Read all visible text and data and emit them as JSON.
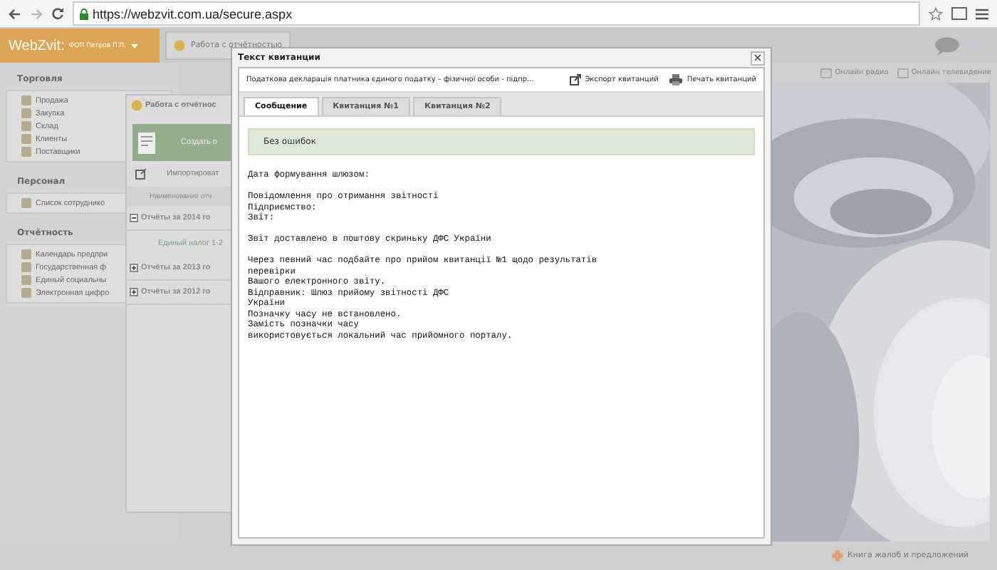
{
  "browser": {
    "url": "https://webzvit.com.ua/secure.aspx"
  },
  "app_header": {
    "logo": "WebZvit:",
    "account": "ФОП Петров П.П.",
    "tab": "Работа с отчётностью"
  },
  "header_links": [
    "Онлайн радио",
    "Онлайн телевидение"
  ],
  "sidebar": [
    {
      "title": "Торговля",
      "items": [
        "Продажа",
        "Закупка",
        "Склад",
        "Клиенты",
        "Поставщики"
      ]
    },
    {
      "title": "Персонал",
      "items": [
        "Список сотруднико"
      ]
    },
    {
      "title": "Отчётность",
      "items": [
        "Календарь предпри",
        "Государственная ф",
        "Единый социальны",
        "Электронная цифро"
      ]
    }
  ],
  "reports_window": {
    "title": "Работа с отчётнос",
    "create_button": "Создать о",
    "import_button": "Импортироват",
    "column_header": "Наименование отч",
    "groups": [
      {
        "label": "Отчёты за 2014 го",
        "expanded": true,
        "children": [
          {
            "label": "Единый налог 1-2"
          }
        ]
      },
      {
        "label": "Отчёты за 2013 го",
        "expanded": false
      },
      {
        "label": "Отчёты за 2012 го",
        "expanded": false
      }
    ]
  },
  "dialog": {
    "title": "Текст квитанции",
    "close": "×",
    "document": "Податкова декларація платника єдиного податку – фізичної особи - підпр...",
    "actions": [
      "Экспорт квитанций",
      "Печать квитанций"
    ],
    "tabs": [
      {
        "label": "Сообщение",
        "selected": true
      },
      {
        "label": "Квитанция №1",
        "selected": false
      },
      {
        "label": "Квитанция №2",
        "selected": false
      }
    ],
    "status": "Без ошибок",
    "paragraphs": [
      [
        "Дата формування шлюзом:"
      ],
      [
        "Повідомлення про отримання звітності",
        "Підприємство:",
        "Звіт:"
      ],
      [
        "Звіт доставлено в поштову скриньку ДФС України"
      ],
      [
        "Через певний час подбайте про прийом квитанції №1 щодо результатів",
        "перевірки",
        "Вашого електронного звіту.",
        "Відправник: Шлюз прийому звітності ДФС",
        "України",
        "Позначку часу не встановлено.",
        "Замість позначки часу",
        "використовується локальний час прийомного порталу."
      ]
    ]
  },
  "footer_link": "Книга жалоб и предложений"
}
